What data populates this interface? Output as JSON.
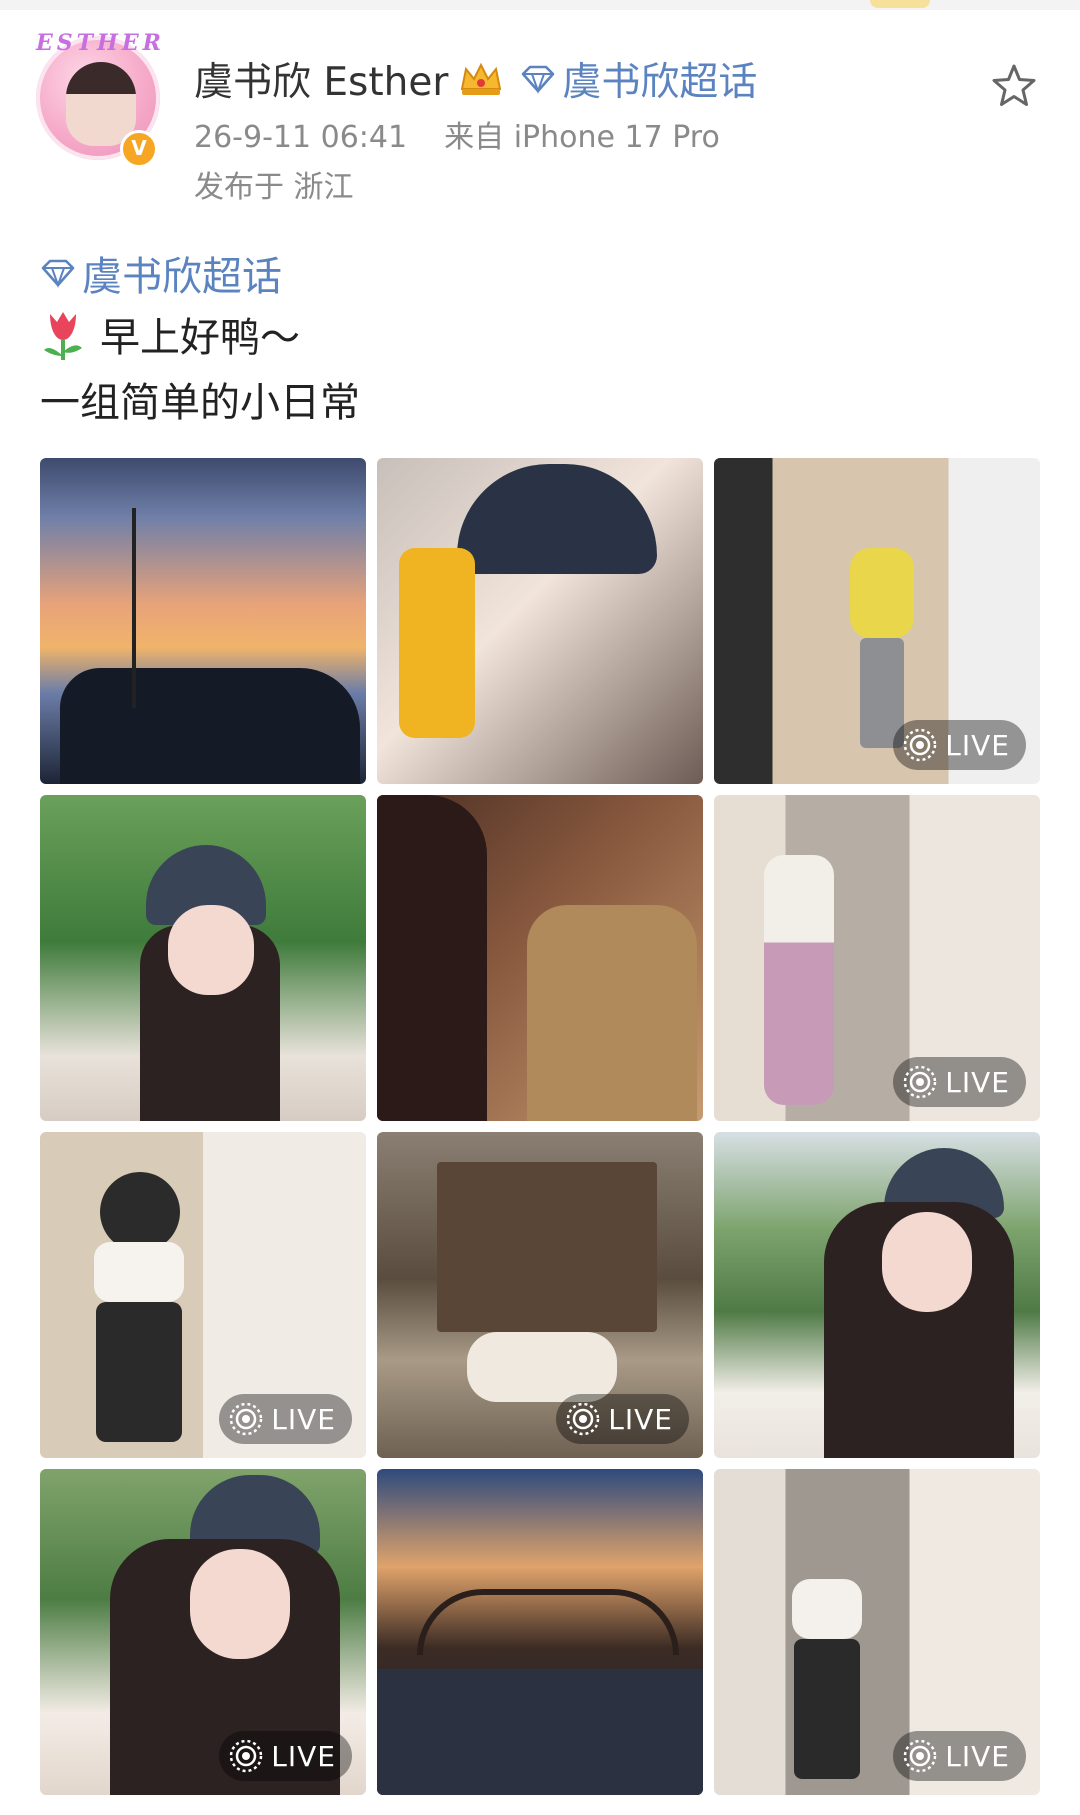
{
  "post": {
    "author": {
      "name": "虞书欣 Esther",
      "avatar_ring_text": "ESTHER",
      "verified_badge": "V"
    },
    "supertopic_label": "虞书欣超话",
    "timestamp": "26-9-11 06:41",
    "source": "来自 iPhone 17 Pro",
    "location": "发布于 浙江",
    "topic_tag": "虞书欣超话",
    "lines": [
      "早上好鸭～",
      "一组简单的小日常"
    ],
    "icons": [
      "crown-icon",
      "gem-icon",
      "star-icon",
      "tulip-icon",
      "live-icon"
    ],
    "colors": {
      "link": "#5b83c0",
      "meta": "#8a8a8a",
      "badge": "#f6a623"
    }
  },
  "photos": [
    {
      "id": "sunset",
      "live": false
    },
    {
      "id": "selfie-cap",
      "live": false
    },
    {
      "id": "elevator-yellow",
      "live": true,
      "live_label": "LIVE"
    },
    {
      "id": "trees-peace",
      "live": false
    },
    {
      "id": "room-friends",
      "live": false
    },
    {
      "id": "elevator-skirt",
      "live": true,
      "live_label": "LIVE"
    },
    {
      "id": "elevator-black",
      "live": true,
      "live_label": "LIVE"
    },
    {
      "id": "village-goats",
      "live": true,
      "live_label": "LIVE"
    },
    {
      "id": "outdoor-cap",
      "live": false
    },
    {
      "id": "outdoor-smile",
      "live": true,
      "live_label": "LIVE"
    },
    {
      "id": "night-bridge",
      "live": false
    },
    {
      "id": "elevator-bag",
      "live": true,
      "live_label": "LIVE"
    }
  ]
}
